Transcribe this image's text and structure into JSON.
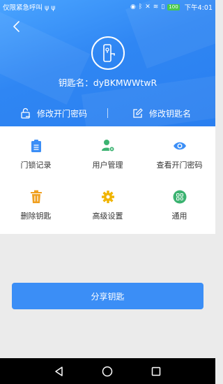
{
  "status_bar": {
    "left_text": "仅限紧急呼叫 ψ ψ",
    "battery": "100",
    "time": "下午4:01"
  },
  "header": {
    "key_name": "钥匙名：dyBKMWWtwR",
    "actions": [
      {
        "label": "修改开门密码",
        "icon": "lock-edit-icon"
      },
      {
        "label": "修改钥匙名",
        "icon": "edit-icon"
      }
    ]
  },
  "grid": [
    {
      "label": "门锁记录",
      "icon": "clipboard-icon",
      "color": "#3b8ef6"
    },
    {
      "label": "用户管理",
      "icon": "user-gear-icon",
      "color": "#3cb371"
    },
    {
      "label": "查看开门密码",
      "icon": "eye-icon",
      "color": "#3b8ef6"
    },
    {
      "label": "删除钥匙",
      "icon": "trash-icon",
      "color": "#f0a020"
    },
    {
      "label": "高级设置",
      "icon": "gear-icon",
      "color": "#f0b400"
    },
    {
      "label": "通用",
      "icon": "apps-icon",
      "color": "#3cb371"
    }
  ],
  "share_button": "分享钥匙",
  "colors": {
    "header_blue": "#2f86f3",
    "button_blue": "#3b8ef6",
    "background": "#ebebeb"
  }
}
